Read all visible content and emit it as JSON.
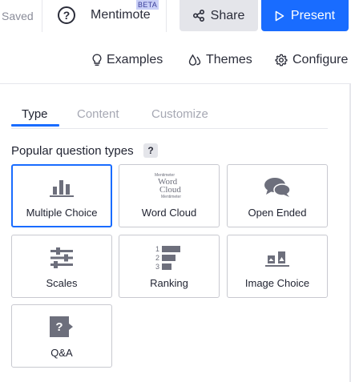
{
  "header": {
    "saved_text": "Saved",
    "help_label": "?",
    "app_name": "Mentimote",
    "beta_badge": "BETA",
    "share_label": "Share",
    "present_label": "Present"
  },
  "toolbar": {
    "examples_label": "Examples",
    "themes_label": "Themes",
    "configure_label": "Configure"
  },
  "tabs": [
    {
      "label": "Type",
      "active": true
    },
    {
      "label": "Content",
      "active": false
    },
    {
      "label": "Customize",
      "active": false
    }
  ],
  "section": {
    "title": "Popular question types",
    "help": "?"
  },
  "question_types": [
    {
      "label": "Multiple Choice",
      "icon": "bar-chart-icon",
      "selected": true
    },
    {
      "label": "Word Cloud",
      "icon": "word-cloud-icon",
      "selected": false
    },
    {
      "label": "Open Ended",
      "icon": "speech-bubbles-icon",
      "selected": false
    },
    {
      "label": "Scales",
      "icon": "sliders-icon",
      "selected": false
    },
    {
      "label": "Ranking",
      "icon": "ranking-icon",
      "selected": false
    },
    {
      "label": "Image Choice",
      "icon": "image-choice-icon",
      "selected": false
    },
    {
      "label": "Q&A",
      "icon": "qa-icon",
      "selected": false
    }
  ],
  "word_cloud_icon_text": {
    "line1": "Mentimeter",
    "line1b": "Word",
    "big1": "Word",
    "line2": "Cloud",
    "big2": "Cloud",
    "line3": "Mentimeter"
  },
  "ranking_numbers": [
    "1",
    "2",
    "3"
  ],
  "qa_icon_text": "?",
  "colors": {
    "accent": "#196cff",
    "icon_gray": "#6d6f7c",
    "border": "#c8c9d0"
  }
}
